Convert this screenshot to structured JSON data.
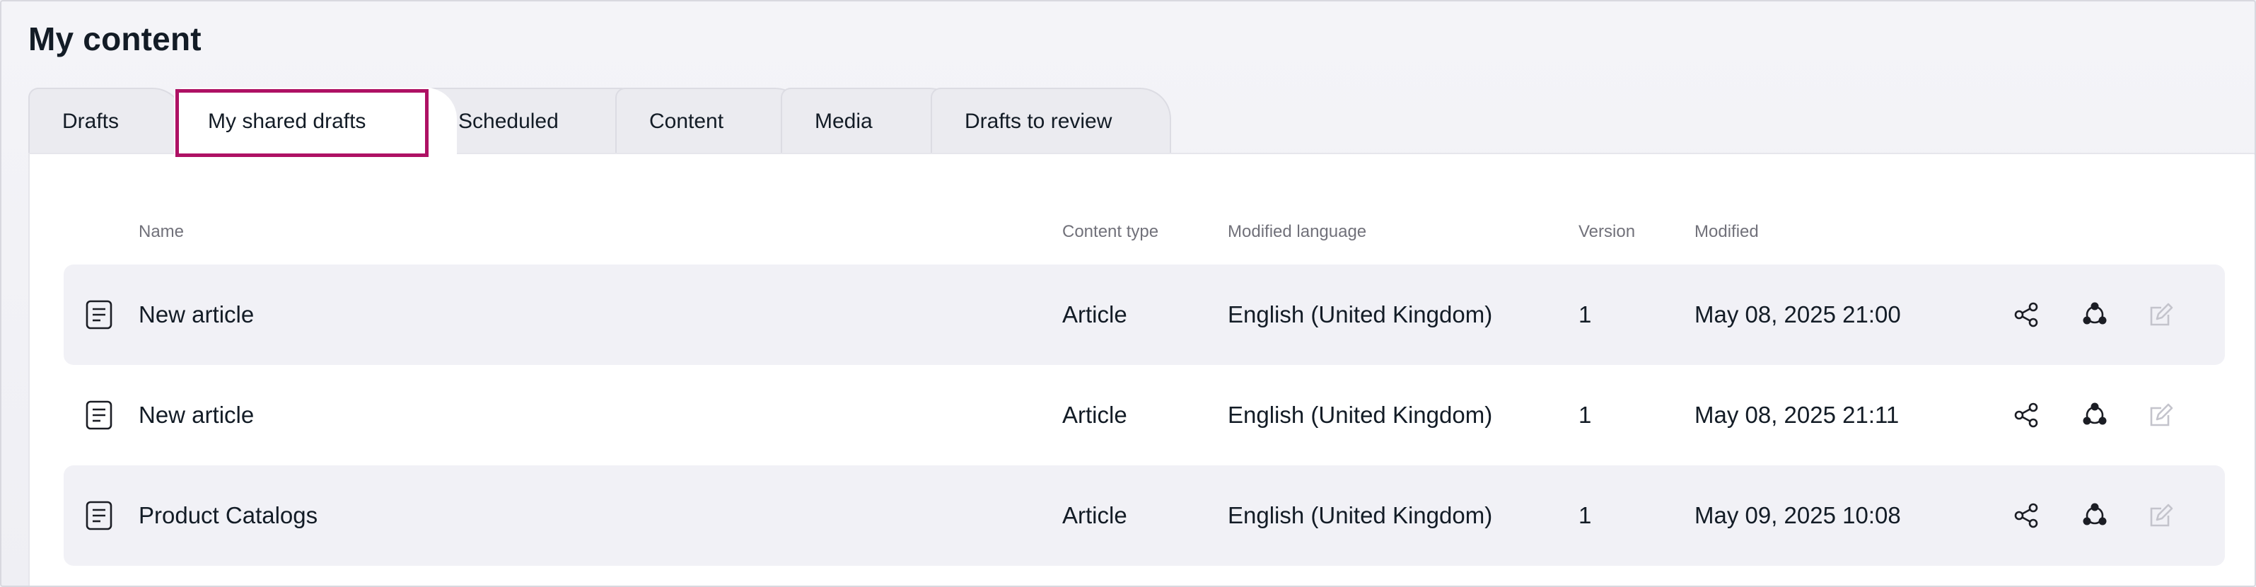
{
  "page": {
    "title": "My content"
  },
  "tabs": [
    {
      "label": "Drafts",
      "active": false
    },
    {
      "label": "My shared drafts",
      "active": true
    },
    {
      "label": "Scheduled",
      "active": false
    },
    {
      "label": "Content",
      "active": false
    },
    {
      "label": "Media",
      "active": false
    },
    {
      "label": "Drafts to review",
      "active": false
    }
  ],
  "table": {
    "columns": {
      "name": "Name",
      "content_type": "Content type",
      "modified_language": "Modified language",
      "version": "Version",
      "modified": "Modified"
    },
    "rows": [
      {
        "name": "New article",
        "content_type": "Article",
        "language": "English (United Kingdom)",
        "version": "1",
        "modified": "May 08, 2025 21:00"
      },
      {
        "name": "New article",
        "content_type": "Article",
        "language": "English (United Kingdom)",
        "version": "1",
        "modified": "May 08, 2025 21:11"
      },
      {
        "name": "Product Catalogs",
        "content_type": "Article",
        "language": "English (United Kingdom)",
        "version": "1",
        "modified": "May 09, 2025 10:08"
      }
    ],
    "row_icon": "document-icon",
    "actions": [
      "share-icon",
      "collaborators-icon",
      "edit-icon"
    ]
  },
  "colors": {
    "highlight": "#ae1164",
    "text": "#131c26",
    "muted": "#71717a",
    "row_shade": "#f1f1f6",
    "disabled_icon": "#c4c4cc"
  }
}
